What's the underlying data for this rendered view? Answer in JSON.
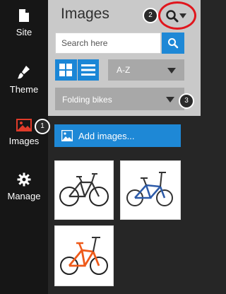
{
  "sidebar": {
    "items": [
      {
        "label": "Site",
        "icon": "document-icon"
      },
      {
        "label": "Theme",
        "icon": "brush-icon"
      },
      {
        "label": "Images",
        "icon": "image-icon",
        "active": true
      },
      {
        "label": "Manage",
        "icon": "gear-icon"
      }
    ]
  },
  "header": {
    "title": "Images"
  },
  "search": {
    "placeholder": "Search here",
    "value": ""
  },
  "sort": {
    "selected": "A-Z"
  },
  "folder": {
    "selected": "Folding bikes"
  },
  "add_button": {
    "label": "Add images..."
  },
  "badges": [
    "1",
    "2",
    "3"
  ],
  "images": [
    {
      "name": "black-folding-bike"
    },
    {
      "name": "blue-folding-bike"
    },
    {
      "name": "orange-folding-bike"
    }
  ],
  "colors": {
    "accent": "#1e88d6",
    "rail": "#161616",
    "panel": "#262626",
    "toolbar": "#c9c9c9",
    "highlight": "#e0161d"
  }
}
